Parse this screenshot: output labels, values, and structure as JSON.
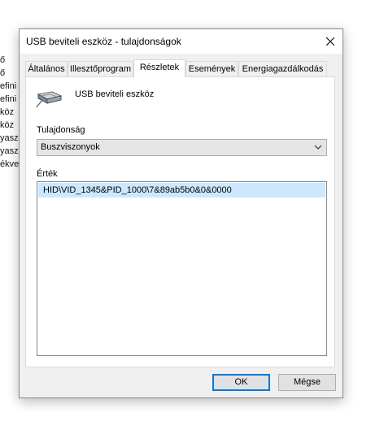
{
  "background_fragments": [
    "ő",
    "ő",
    "efini",
    "efini",
    "köz",
    "köz",
    "yasz",
    "yasz",
    "ékve"
  ],
  "dialog": {
    "title": "USB beviteli eszköz - tulajdonságok",
    "tabs": [
      {
        "label": "Általános",
        "active": false
      },
      {
        "label": "Illesztőprogram",
        "active": false
      },
      {
        "label": "Részletek",
        "active": true
      },
      {
        "label": "Események",
        "active": false
      },
      {
        "label": "Energiagazdálkodás",
        "active": false
      }
    ],
    "device_name": "USB beviteli eszköz",
    "property_label": "Tulajdonság",
    "property_selected": "Buszviszonyok",
    "value_label": "Érték",
    "values": [
      "HID\\VID_1345&PID_1000\\7&89ab5b0&0&0000"
    ],
    "ok_label": "OK",
    "cancel_label": "Mégse"
  },
  "colors": {
    "accent": "#0078d7",
    "selection": "#cce8ff",
    "dialog_bg": "#f0f0f0"
  },
  "icons": {
    "close": "close-icon",
    "device": "usb-input-device-icon",
    "dropdown": "chevron-down-icon"
  }
}
